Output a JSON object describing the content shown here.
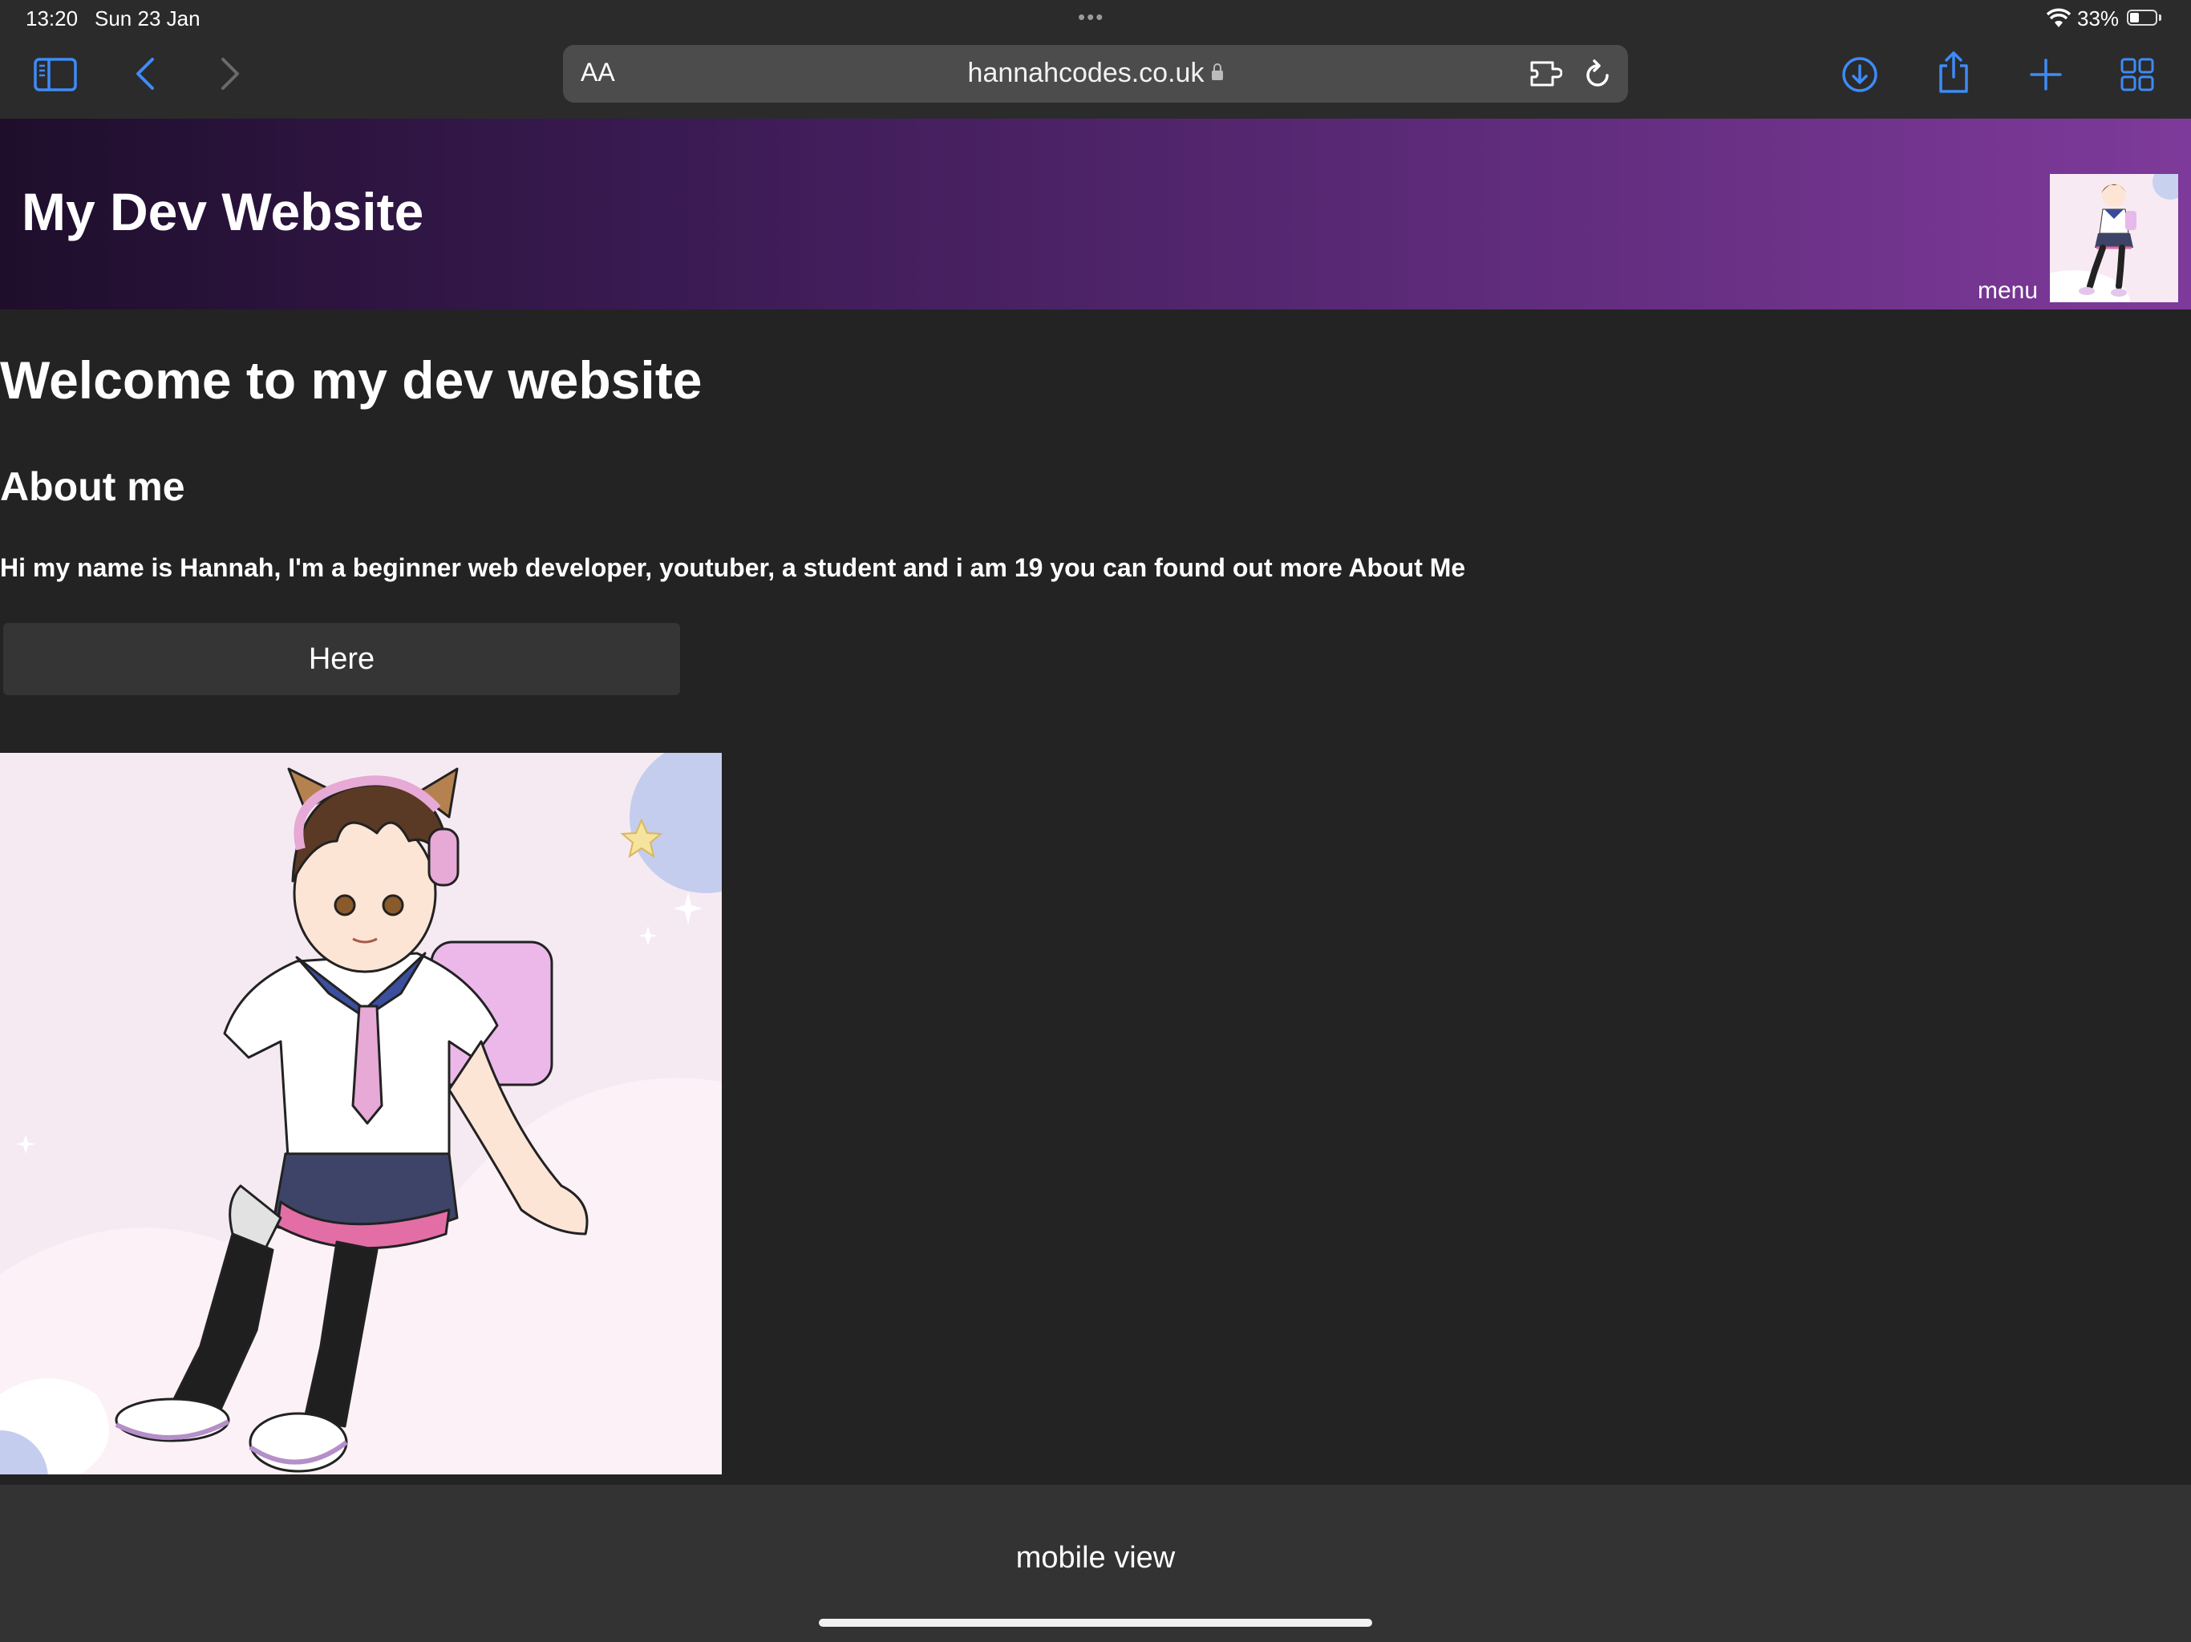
{
  "status_bar": {
    "time": "13:20",
    "date": "Sun 23 Jan",
    "battery_percent": "33%",
    "battery_level": 0.33
  },
  "browser": {
    "address_text_size_label": "AA",
    "url": "hannahcodes.co.uk",
    "accent_color": "#3e8bf7",
    "icons": [
      "sidebar-icon",
      "back-icon",
      "forward-icon",
      "extensions-icon",
      "reload-icon",
      "download-icon",
      "share-icon",
      "new-tab-icon",
      "tabs-overview-icon"
    ]
  },
  "header": {
    "title": "My Dev Website",
    "menu_label": "menu",
    "gradient_colors": [
      "#1e0e2b",
      "#7e3a9a"
    ]
  },
  "main": {
    "heading": "Welcome to my dev website",
    "subheading": "About me",
    "paragraph": "Hi my name is Hannah, I'm a beginner web developer, youtuber, a student and i am 19 you can found out more About Me",
    "button_label": "Here"
  },
  "footer": {
    "label": "mobile view"
  }
}
